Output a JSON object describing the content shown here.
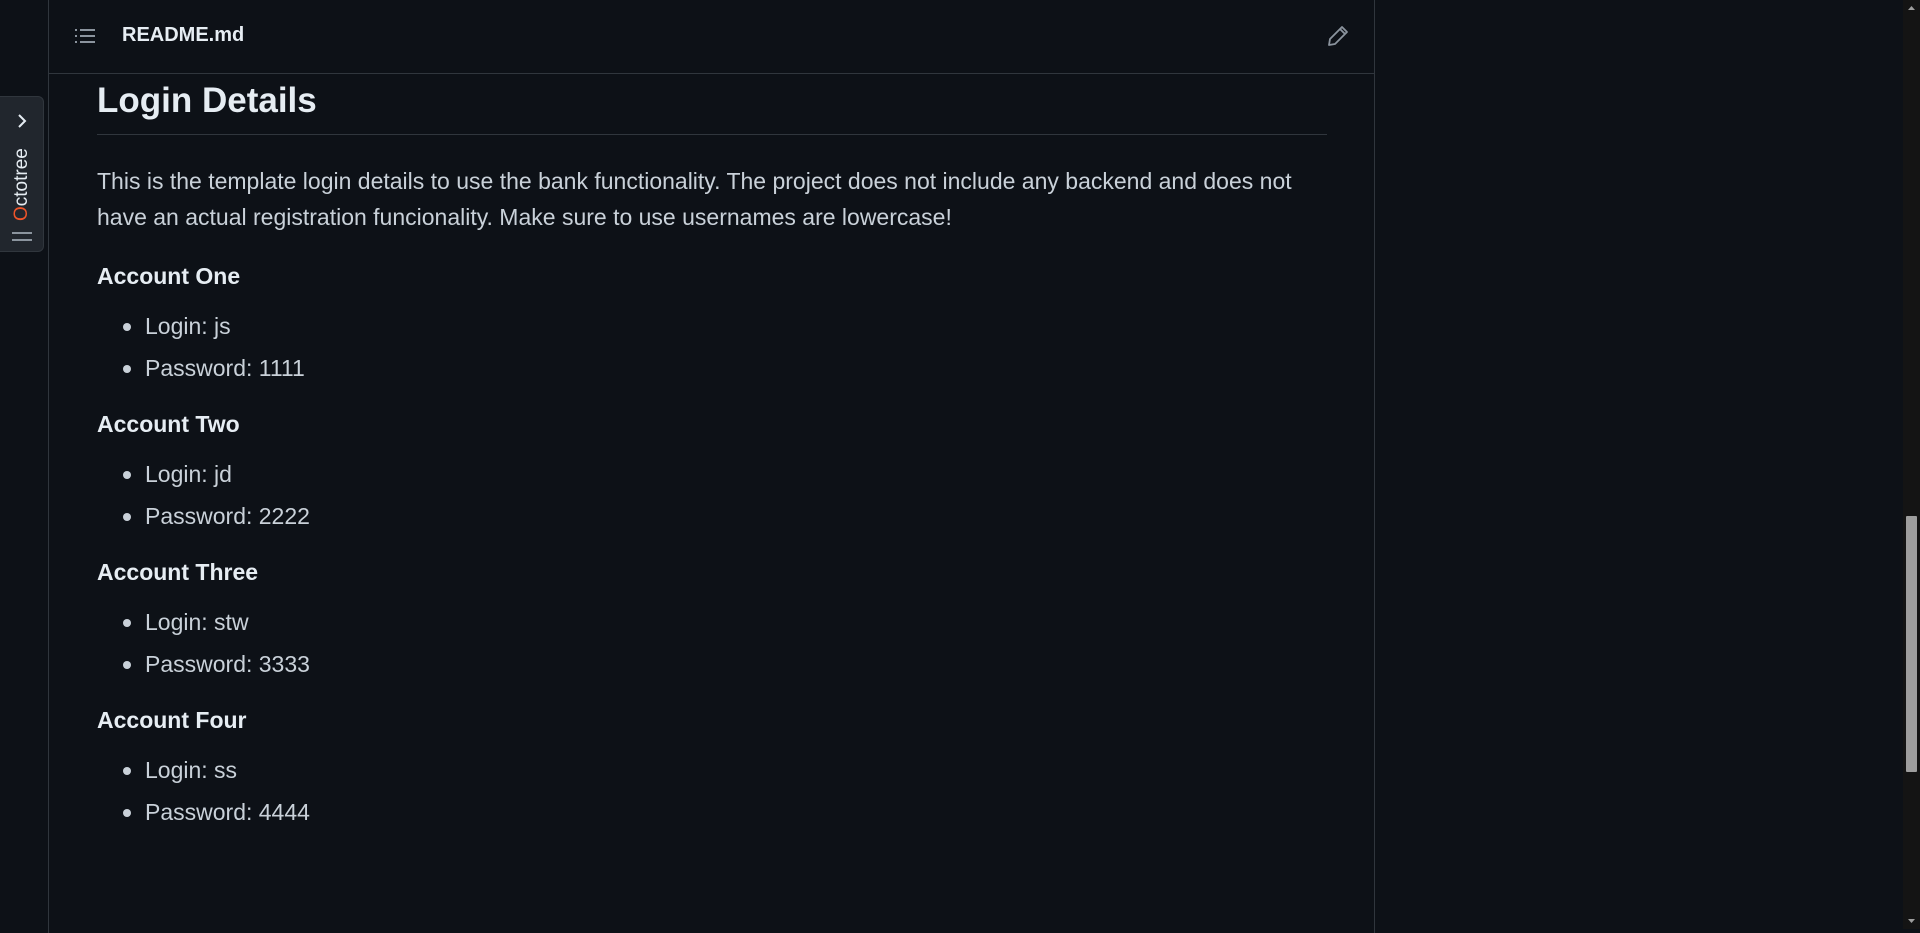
{
  "octotree": {
    "label_first": "O",
    "label_rest": "ctotree",
    "expand_icon": "chevron-right-icon",
    "menu_icon": "menu-lines-icon"
  },
  "header": {
    "file_name": "README.md",
    "toc_icon": "list-unordered-icon",
    "edit_icon": "pencil-icon"
  },
  "content": {
    "heading": "Login Details",
    "intro": "This is the template login details to use the bank functionality. The project does not include any backend and does not have an actual registration funcionality. Make sure to use usernames are lowercase!",
    "accounts": [
      {
        "title": "Account One",
        "login": "Login: js",
        "password": "Password: 1111"
      },
      {
        "title": "Account Two",
        "login": "Login: jd",
        "password": "Password: 2222"
      },
      {
        "title": "Account Three",
        "login": "Login: stw",
        "password": "Password: 3333"
      },
      {
        "title": "Account Four",
        "login": "Login: ss",
        "password": "Password: 4444"
      }
    ]
  },
  "colors": {
    "background": "#0d1117",
    "border": "#30363d",
    "text": "#c9d1d9",
    "heading": "#e6edf3",
    "octotree_accent": "#f0552a"
  },
  "scrollbar": {
    "position_fraction": 0.63
  }
}
